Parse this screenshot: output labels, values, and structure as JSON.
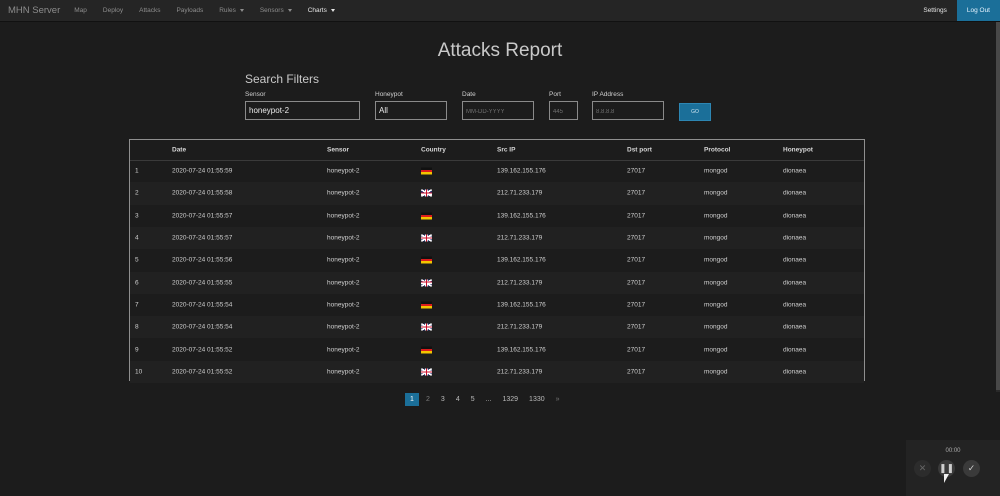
{
  "navbar": {
    "brand": "MHN Server",
    "items": [
      {
        "label": "Map",
        "dropdown": false,
        "active": false
      },
      {
        "label": "Deploy",
        "dropdown": false,
        "active": false
      },
      {
        "label": "Attacks",
        "dropdown": false,
        "active": false
      },
      {
        "label": "Payloads",
        "dropdown": false,
        "active": false
      },
      {
        "label": "Rules",
        "dropdown": true,
        "active": false
      },
      {
        "label": "Sensors",
        "dropdown": true,
        "active": false
      },
      {
        "label": "Charts",
        "dropdown": true,
        "active": true
      }
    ],
    "settings": "Settings",
    "logout": "Log Out"
  },
  "page_title": "Attacks Report",
  "filters": {
    "title": "Search Filters",
    "sensor": {
      "label": "Sensor",
      "value": "honeypot-2",
      "placeholder": ""
    },
    "honeypot": {
      "label": "Honeypot",
      "value": "All",
      "placeholder": ""
    },
    "date": {
      "label": "Date",
      "value": "",
      "placeholder": "MM-DD-YYYY"
    },
    "port": {
      "label": "Port",
      "value": "",
      "placeholder": "445"
    },
    "ip": {
      "label": "IP Address",
      "value": "",
      "placeholder": "8.8.8.8"
    },
    "go": "GO"
  },
  "table": {
    "headers": [
      "",
      "Date",
      "Sensor",
      "Country",
      "Src IP",
      "Dst port",
      "Protocol",
      "Honeypot"
    ],
    "rows": [
      {
        "num": "1",
        "date": "2020-07-24 01:55:59",
        "sensor": "honeypot-2",
        "flag": "de",
        "src": "139.162.155.176",
        "dst": "27017",
        "proto": "mongod",
        "honeypot": "dionaea"
      },
      {
        "num": "2",
        "date": "2020-07-24 01:55:58",
        "sensor": "honeypot-2",
        "flag": "gb",
        "src": "212.71.233.179",
        "dst": "27017",
        "proto": "mongod",
        "honeypot": "dionaea"
      },
      {
        "num": "3",
        "date": "2020-07-24 01:55:57",
        "sensor": "honeypot-2",
        "flag": "de",
        "src": "139.162.155.176",
        "dst": "27017",
        "proto": "mongod",
        "honeypot": "dionaea"
      },
      {
        "num": "4",
        "date": "2020-07-24 01:55:57",
        "sensor": "honeypot-2",
        "flag": "gb",
        "src": "212.71.233.179",
        "dst": "27017",
        "proto": "mongod",
        "honeypot": "dionaea"
      },
      {
        "num": "5",
        "date": "2020-07-24 01:55:56",
        "sensor": "honeypot-2",
        "flag": "de",
        "src": "139.162.155.176",
        "dst": "27017",
        "proto": "mongod",
        "honeypot": "dionaea"
      },
      {
        "num": "6",
        "date": "2020-07-24 01:55:55",
        "sensor": "honeypot-2",
        "flag": "gb",
        "src": "212.71.233.179",
        "dst": "27017",
        "proto": "mongod",
        "honeypot": "dionaea"
      },
      {
        "num": "7",
        "date": "2020-07-24 01:55:54",
        "sensor": "honeypot-2",
        "flag": "de",
        "src": "139.162.155.176",
        "dst": "27017",
        "proto": "mongod",
        "honeypot": "dionaea"
      },
      {
        "num": "8",
        "date": "2020-07-24 01:55:54",
        "sensor": "honeypot-2",
        "flag": "gb",
        "src": "212.71.233.179",
        "dst": "27017",
        "proto": "mongod",
        "honeypot": "dionaea"
      },
      {
        "num": "9",
        "date": "2020-07-24 01:55:52",
        "sensor": "honeypot-2",
        "flag": "de",
        "src": "139.162.155.176",
        "dst": "27017",
        "proto": "mongod",
        "honeypot": "dionaea"
      },
      {
        "num": "10",
        "date": "2020-07-24 01:55:52",
        "sensor": "honeypot-2",
        "flag": "gb",
        "src": "212.71.233.179",
        "dst": "27017",
        "proto": "mongod",
        "honeypot": "dionaea"
      }
    ]
  },
  "pagination": {
    "pages": [
      "1",
      "2",
      "3",
      "4",
      "5",
      "...",
      "1329",
      "1330",
      "»"
    ],
    "active": "1"
  },
  "recorder": {
    "time": "00:00",
    "buttons": [
      "close-icon",
      "pause-icon",
      "check-icon"
    ]
  }
}
